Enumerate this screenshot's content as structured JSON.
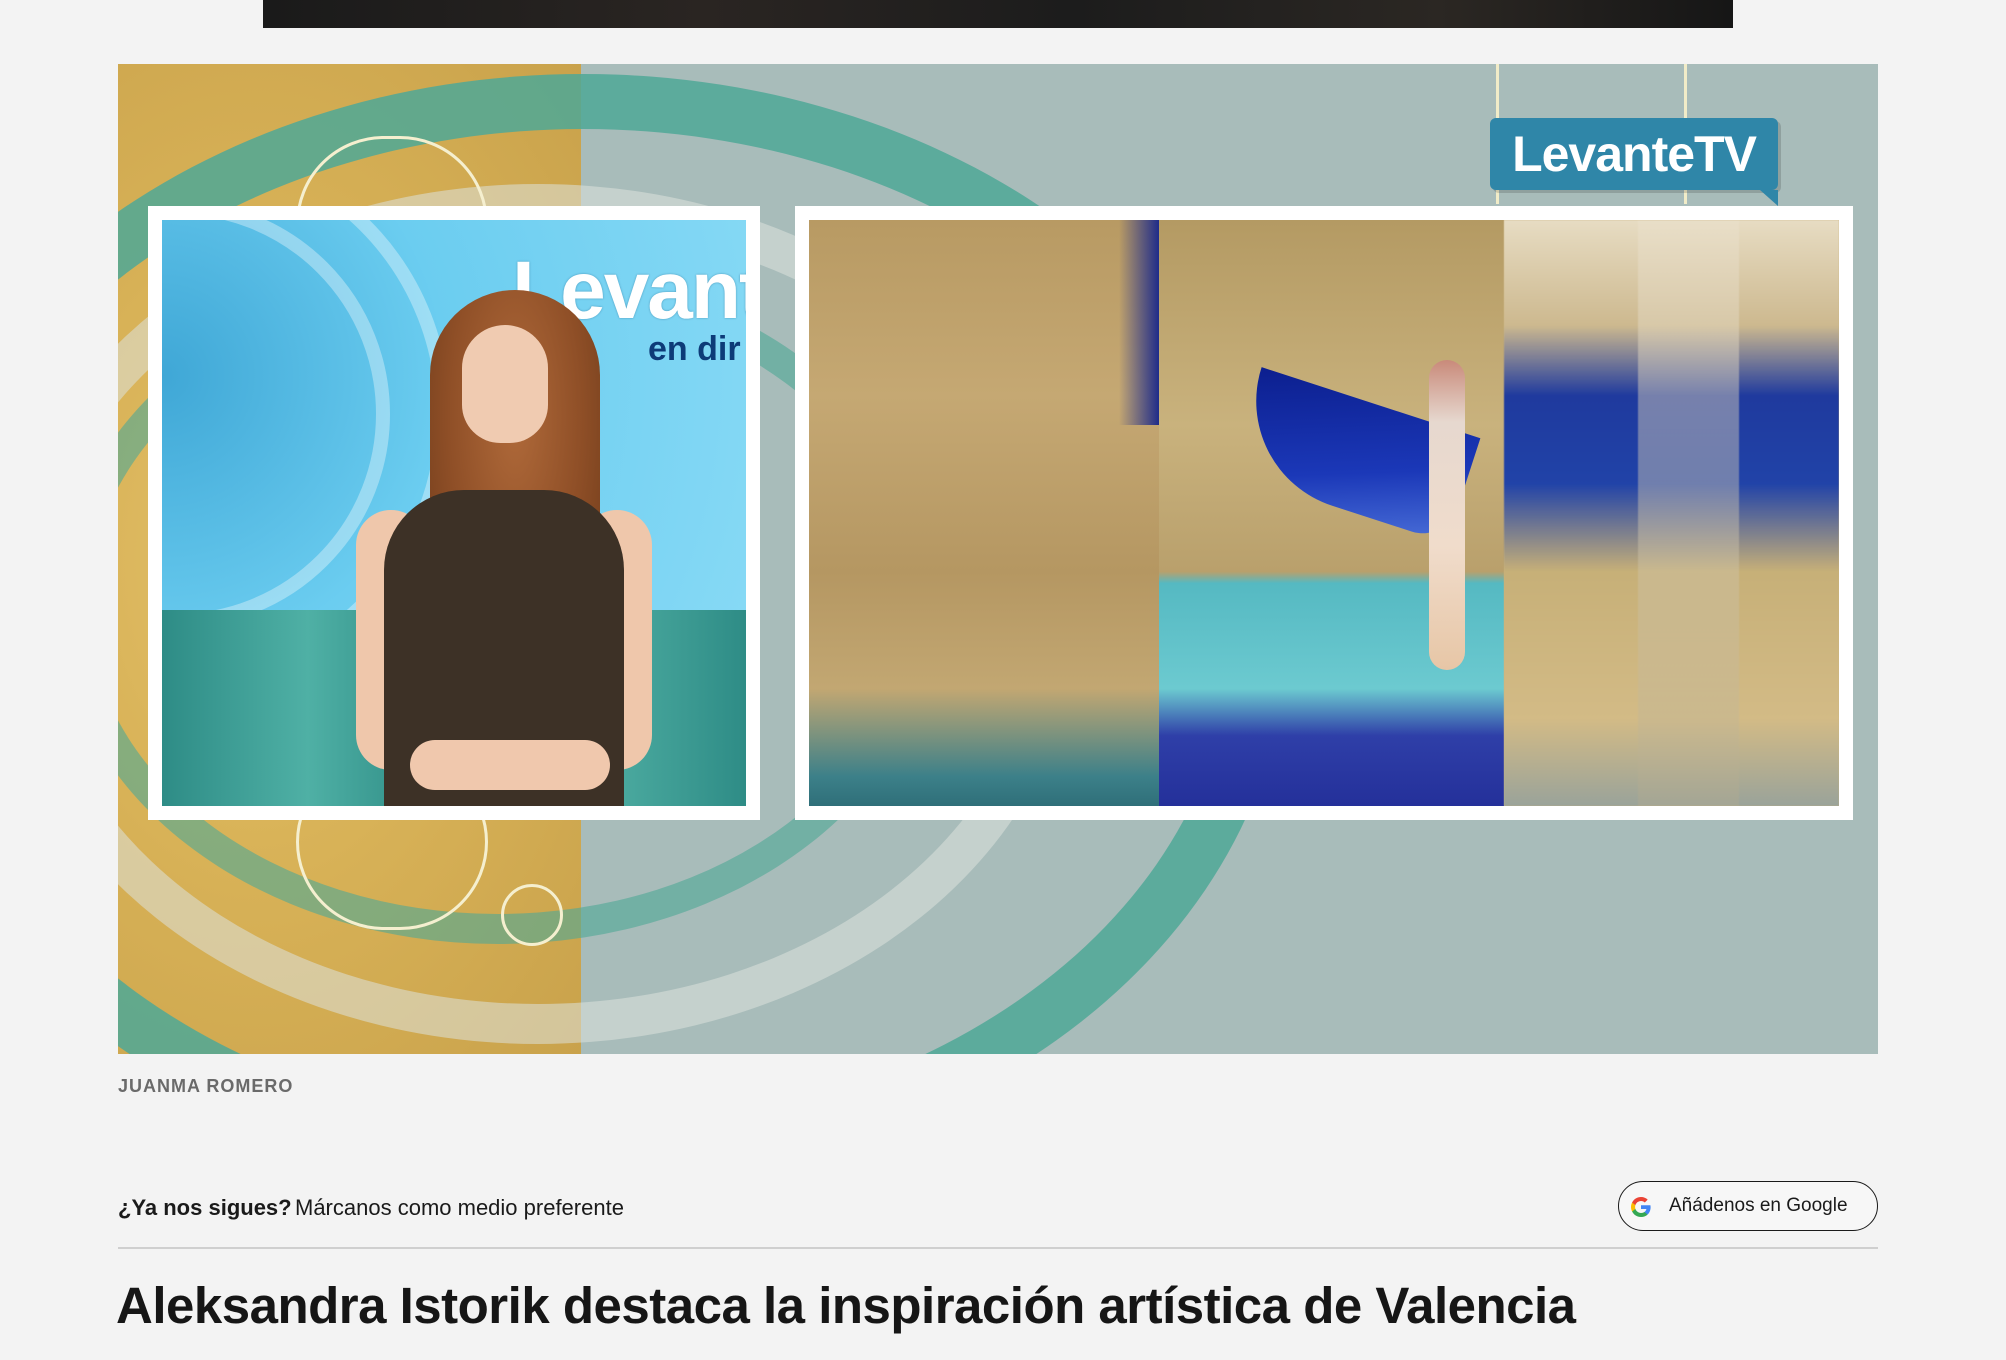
{
  "media": {
    "logo_text": "LevanteTV",
    "studio_backdrop_text": "Levant",
    "studio_backdrop_subtext": "en dir"
  },
  "credit": "JUANMA ROMERO",
  "follow": {
    "question": "¿Ya nos sigues?",
    "text": "Márcanos como medio preferente",
    "button_label": "Añádenos en Google"
  },
  "headline": "Aleksandra Istorik destaca la inspiración artística de Valencia",
  "colors": {
    "page_bg": "#f3f3f3",
    "logo_bg": "#2f86a8",
    "text": "#161616",
    "credit": "#6a6a6a"
  },
  "icons": [
    "google-icon"
  ]
}
